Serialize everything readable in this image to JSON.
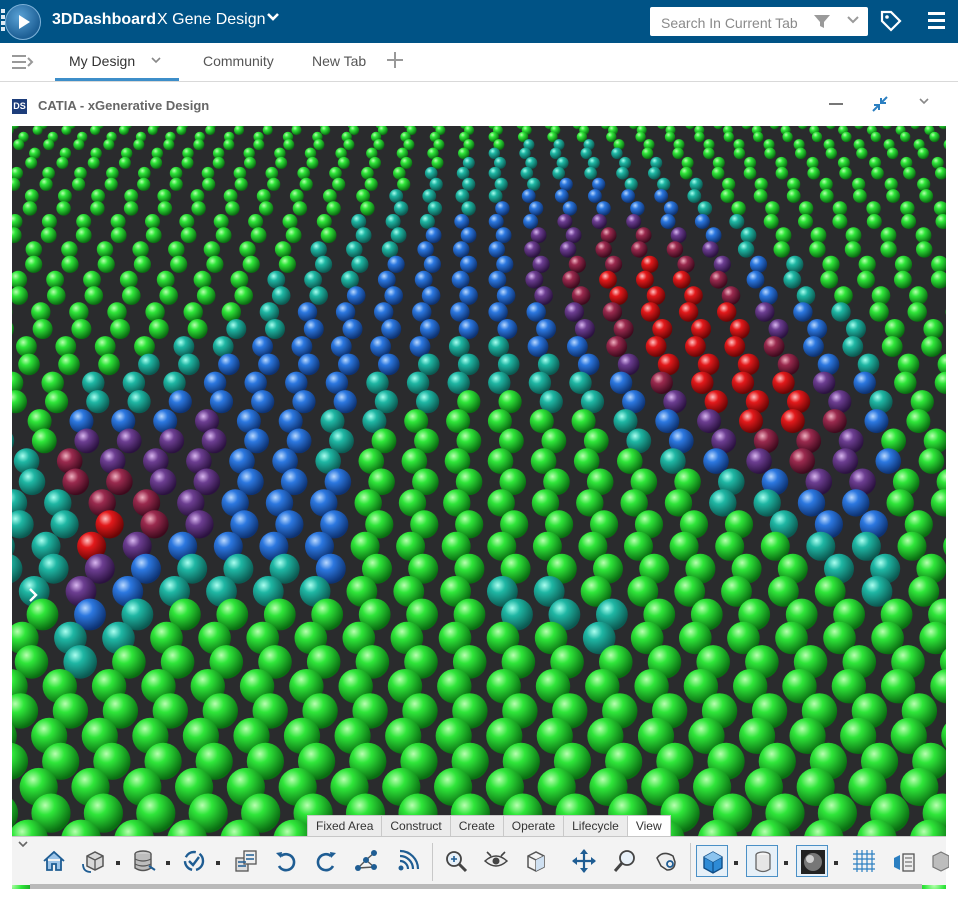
{
  "topbar": {
    "brand": "3DDashboard",
    "dashboard_name": "X Gene Design",
    "search_placeholder": "Search In Current Tab"
  },
  "tabs": [
    {
      "label": "My Design",
      "active": true
    },
    {
      "label": "Community",
      "active": false
    },
    {
      "label": "New Tab",
      "active": false
    }
  ],
  "panel": {
    "logo": "3DS",
    "title": "CATIA - xGenerative Design"
  },
  "workbench_tabs": [
    {
      "label": "Fixed Area",
      "active": false
    },
    {
      "label": "Construct",
      "active": false
    },
    {
      "label": "Create",
      "active": false
    },
    {
      "label": "Operate",
      "active": false
    },
    {
      "label": "Lifecycle",
      "active": false
    },
    {
      "label": "View",
      "active": true
    }
  ],
  "colors": {
    "topbar": "#005386",
    "accent": "#3d8ec9",
    "viewport_bg": "#2a2b2d",
    "sphere_red": "#e01a1a",
    "sphere_purple": "#6a3a8c",
    "sphere_blue": "#2a6fd6",
    "sphere_teal": "#1fa89a",
    "sphere_green": "#22d12c"
  },
  "toolbar": {
    "tools": [
      "home-icon",
      "box-rotate-icon",
      "database-icon",
      "sync-check-icon",
      "transfer-icon",
      "undo-icon",
      "redo-icon",
      "graph-nodes-icon",
      "wireless-icon",
      "zoom-target-icon",
      "eye-rotate-icon",
      "cube-outline-icon",
      "move-arrows-icon",
      "zoom-icon",
      "hand-rotate-icon",
      "shaded-cube-icon",
      "cylinder-icon",
      "sphere-render-icon",
      "grid-icon",
      "view-mode-icon",
      "cube-grey-icon"
    ]
  }
}
